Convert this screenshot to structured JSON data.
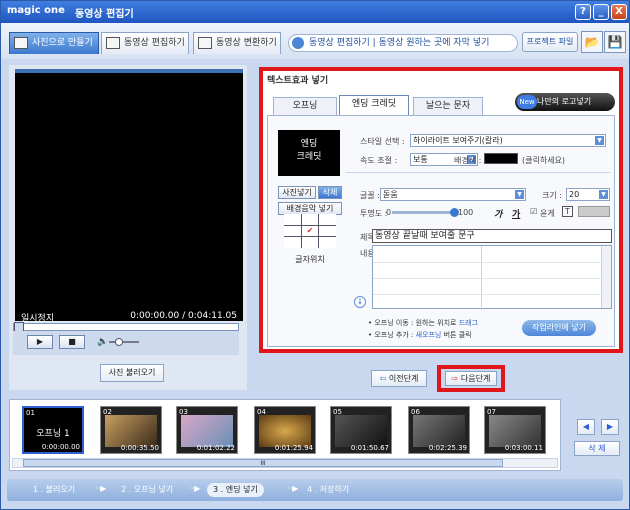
{
  "app": {
    "brand": "magic one",
    "title": "동영상 편집기",
    "controls": {
      "help": "?",
      "min": "_",
      "close": "X"
    }
  },
  "top_tabs": [
    {
      "label": "사진으로 만들기",
      "active": true
    },
    {
      "label": "동영상 편집하기",
      "active": false
    },
    {
      "label": "동영상 변환하기",
      "active": false
    }
  ],
  "breadcrumb": "동영상 편집하기  |  동영상 원하는 곳에 자막 넣기",
  "project_button": "프로젝트 파일",
  "player": {
    "status": "일시정지",
    "time": "0:00:00.00 / 0:04:11.05",
    "play": "▶",
    "stop": "■"
  },
  "photo_load_button": "사진 불러오기",
  "editor": {
    "panel_title": "텍스트효과 넣기",
    "tabs": [
      {
        "label": "오프닝",
        "active": false
      },
      {
        "label": "엔딩 크레딧",
        "active": true
      },
      {
        "label": "날으는 문자",
        "active": false
      }
    ],
    "logo_badge": "New",
    "logo_button": "나만의 로고넣기",
    "preview_line1": "엔딩",
    "preview_line2": "크레딧",
    "insert_photo": "사진넣기",
    "delete": "삭제",
    "insert_bgm": "배경음악 넣기",
    "position_label": "글자위치",
    "style_label": "스타일 선택 :",
    "style_value": "하이라이트 보여주기(칼라)",
    "speed_label": "속도 조절 :",
    "speed_value": "보통",
    "bgcolor_label": "배경색 :",
    "bgcolor_hint": "(클릭하세요)",
    "font_label": "글꼴 :",
    "font_value": "돋움",
    "size_label": "크기 :",
    "size_value": "20",
    "opacity_label": "투명도 :",
    "opacity_min": "0",
    "opacity_max": "100",
    "opacity_value": 100,
    "shadow_label": "윤게",
    "title_label": "제목 :",
    "title_value": "동영상 끝날때 보여줄 문구",
    "content_label": "내용 :",
    "hint1_prefix": "• 오프닝 이동 : 원하는 위치로",
    "hint1_link": "드래그",
    "hint2_prefix": "• 오프닝 추가 :",
    "hint2_link": "새오프닝",
    "hint2_suffix": "버튼 클릭",
    "subtitle_button": "작업라인에 넣기",
    "bg_color": "#000000"
  },
  "nav": {
    "prev": "이전단계",
    "next": "다음단계"
  },
  "timeline": {
    "thumbs": [
      {
        "idx": "01",
        "name": "오프닝 1",
        "time": "0:00:00.00"
      },
      {
        "idx": "02",
        "name": "",
        "time": "0:00:35.50"
      },
      {
        "idx": "03",
        "name": "",
        "time": "0:01:02.22"
      },
      {
        "idx": "04",
        "name": "",
        "time": "0:01:25.94"
      },
      {
        "idx": "05",
        "name": "",
        "time": "0:01:50.67"
      },
      {
        "idx": "06",
        "name": "",
        "time": "0:02:25.39"
      },
      {
        "idx": "07",
        "name": "",
        "time": "0:03:00.11"
      }
    ],
    "scroll_marker": "III",
    "delete": "삭 제"
  },
  "steps": [
    {
      "label": "1 . 불러오기",
      "current": false
    },
    {
      "label": "2 . 오프닝 넣기",
      "current": false
    },
    {
      "label": "3 . 엔딩 넣기",
      "current": true
    },
    {
      "label": "4 . 저장하기",
      "current": false
    }
  ],
  "colors": {
    "accent": "#2f5fd0",
    "highlight": "#e0161a"
  }
}
